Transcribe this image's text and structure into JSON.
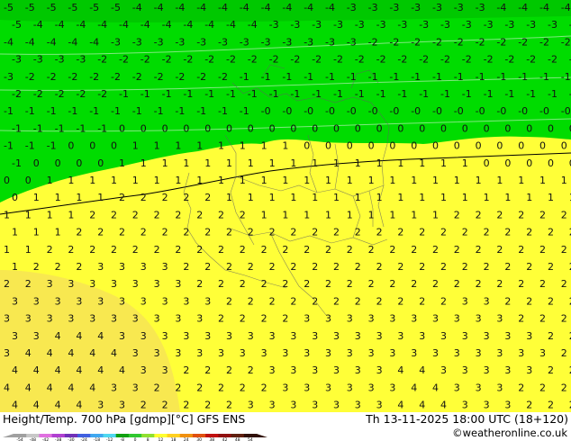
{
  "header": {
    "title": "Height/Temp. 700 hPa [gdmp][°C] GFS ENS",
    "valid_time": "Th 13-11-2025 18:00 UTC (18+120)",
    "credit": "©weatheronline.co.uk"
  },
  "colorbar": {
    "labels": [
      "-54",
      "-48",
      "-42",
      "-38",
      "-30",
      "-24",
      "-18",
      "-12",
      "-8",
      "0",
      "8",
      "12",
      "18",
      "24",
      "30",
      "38",
      "42",
      "48",
      "54"
    ],
    "colors": [
      "#a0a0a0",
      "#c8c8c8",
      "#e070e0",
      "#b040d0",
      "#7030b8",
      "#4060e0",
      "#40a8f0",
      "#50d8f0",
      "#10a010",
      "#30c830",
      "#90e030",
      "#ffff30",
      "#ffd020",
      "#f09010",
      "#e05010",
      "#c01010",
      "#901010",
      "#602010",
      "#301008"
    ]
  },
  "map": {
    "zone_colors": {
      "dark_green": "#00c800",
      "green": "#00dc00",
      "yellow": "#ffff38",
      "light_yellow": "#f8e850"
    },
    "row_values": [
      "-5 -5 -5 -5 -5 -5 -4 -4 -4 -4 -4 -4 -4 -4 -4 -4 -3 -3 -3 -3 -3 -3 -3 -4 -4 -4 -4",
      "-5 -4 -4 -4 -4 -4 -4 -4 -4 -4 -4 -4 -3 -3 -3 -3 -3 -3 -3 -3 -3 -3 -3 -3 -3 -3 -3",
      "-4 -4 -4 -4 -4 -3 -3 -3 -3 -3 -3 -3 -3 -3 -3 -3 -3 -2 -2 -2 -2 -2 -2 -2 -2 -2 -2",
      "-3 -3 -3 -3 -2 -2 -2 -2 -2 -2 -2 -2 -2 -2 -2 -2 -2 -2 -2 -2 -2 -2 -2 -2 -2 -2 -2",
      "-3 -2 -2 -2 -2 -2 -2 -2 -2 -2 -2 -1 -1 -1 -1 -1 -1 -1 -1 -1 -1 -1 -1 -1 -1 -1 -1",
      "-2 -2 -2 -2 -2 -1 -1 -1 -1 -1 -1 -1 -1 -1 -1 -1 -1 -1 -1 -1 -1 -1 -1 -1 -1 -1 -1",
      "-1 -1 -1 -1 -1 -1 -1 -1 -1 -1 -1 -1 -0 -0 -0 -0 -0 -0 -0 -0 -0 -0 -0 -0 -0 -0 -0",
      "-1 -1 -1 -1 -1 0 0 0 0 0 0 0 0 0 0 0 0 0 0 0 0 0 0 0 0 0 0",
      "-1 -1 -1 0 0 0 1 1 1 1 1 1 1 1 0 0 0 0 0 0 0 0 0 0 0 0 0",
      "-1 0 0 0 0 1 1 1 1 1 1 1 1 1 1 1 1 1 1 1 1 1 0 0 0 0 0",
      "0 0 1 1 1 1 1 1 1 1 1 1 1 1 1 1 1 1 1 1 1 1 1 1 1 1 1",
      "0 1 1 1 1 2 2 2 2 2 1 1 1 1 1 1 1 1 1 1 1 1 1 1 1 1 1",
      "1 1 1 1 2 2 2 2 2 2 2 2 1 1 1 1 1 1 1 1 1 2 2 2 2 2 2",
      "1 1 1 2 2 2 2 2 2 2 2 2 2 2 2 2 2 2 2 2 2 2 2 2 2 2 2",
      "1 1 2 2 2 2 2 2 2 2 2 2 2 2 2 2 2 2 2 2 2 2 2 2 2 2 2",
      "1 2 2 2 3 3 3 3 2 2 2 2 2 2 2 2 2 2 2 2 2 2 2 2 2 2 2",
      "2 2 3 3 3 3 3 3 3 2 2 2 2 2 2 2 2 2 2 2 2 2 2 2 2 2 2",
      "3 3 3 3 3 3 3 3 3 3 2 2 2 2 2 2 2 2 2 2 2 3 3 2 2 2 2",
      "3 3 3 3 3 3 3 3 3 3 2 2 2 2 3 3 3 3 3 3 3 3 3 3 2 2 2",
      "3 3 4 4 4 3 3 3 3 3 3 3 3 3 3 3 3 3 3 3 3 3 3 3 3 2 2",
      "3 4 4 4 4 4 3 3 3 3 3 3 3 3 3 3 3 3 3 3 3 3 3 3 3 3 2",
      "4 4 4 4 4 4 3 3 2 2 2 2 3 3 3 3 3 3 4 4 3 3 3 3 3 2 2",
      "4 4 4 4 4 3 3 2 2 2 2 2 2 3 3 3 3 3 3 4 4 3 3 3 2 2 2",
      "4 4 4 4 3 3 2 2 2 2 2 3 3 3 3 3 3 3 4 4 4 3 3 3 2 2 2"
    ]
  }
}
